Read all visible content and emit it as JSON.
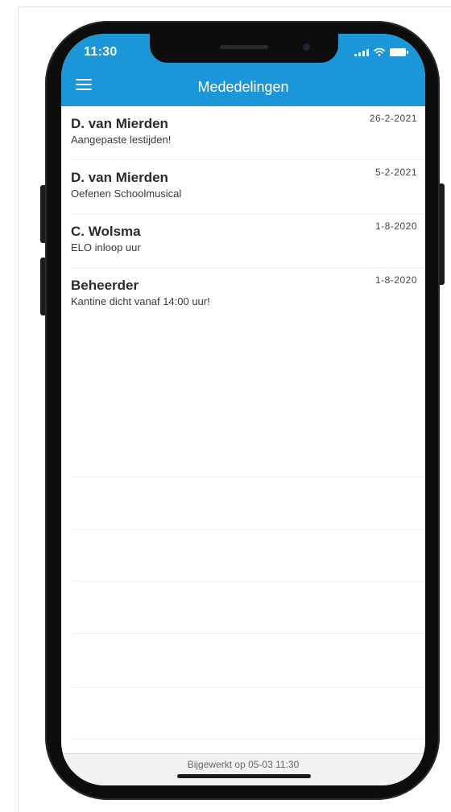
{
  "status_bar": {
    "time": "11:30"
  },
  "header": {
    "title": "Mededelingen",
    "menu_icon": "hamburger-menu-icon",
    "background_color": "#1a96d9"
  },
  "messages": [
    {
      "sender": "D. van Mierden",
      "subject": "Aangepaste lestijden!",
      "date": "26-2-2021"
    },
    {
      "sender": "D. van Mierden",
      "subject": "Oefenen Schoolmusical",
      "date": "5-2-2021"
    },
    {
      "sender": "C. Wolsma",
      "subject": "ELO inloop uur",
      "date": "1-8-2020"
    },
    {
      "sender": "Beheerder",
      "subject": "Kantine dicht vanaf 14:00 uur!",
      "date": "1-8-2020"
    }
  ],
  "footer": {
    "updated": "Bijgewerkt op 05-03 11:30"
  }
}
